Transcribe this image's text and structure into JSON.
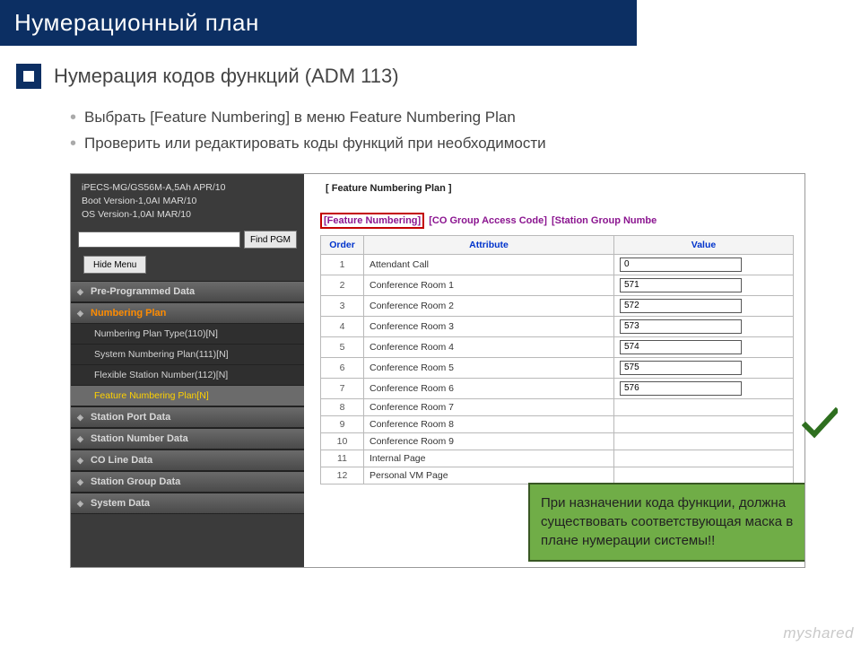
{
  "banner": {
    "title": "Нумерационный план"
  },
  "subtitle": "Нумерация кодов функций (ADM 113)",
  "bullets": [
    "Выбрать [Feature Numbering] в меню Feature Numbering Plan",
    "Проверить или редактировать коды функций при необходимости"
  ],
  "sidebar": {
    "info": [
      "iPECS-MG/GS56M-A,5Ah APR/10",
      "Boot Version-1,0AI MAR/10",
      "OS Version-1,0AI MAR/10"
    ],
    "find_btn": "Find PGM",
    "hide_btn": "Hide Menu",
    "groups": [
      {
        "label": "Pre-Programmed Data",
        "active": false
      },
      {
        "label": "Numbering Plan",
        "active": true,
        "items": [
          {
            "label": "Numbering Plan Type(110)[N]",
            "sel": false
          },
          {
            "label": "System Numbering Plan(111)[N]",
            "sel": false
          },
          {
            "label": "Flexible Station Number(112)[N]",
            "sel": false
          },
          {
            "label": "Feature Numbering Plan[N]",
            "sel": true
          }
        ]
      },
      {
        "label": "Station Port Data",
        "active": false
      },
      {
        "label": "Station Number Data",
        "active": false
      },
      {
        "label": "CO Line Data",
        "active": false
      },
      {
        "label": "Station Group Data",
        "active": false
      },
      {
        "label": "System Data",
        "active": false
      }
    ]
  },
  "content": {
    "breadcrumb": "[  Feature Numbering Plan  ]",
    "tabs": [
      {
        "label": "[Feature Numbering]",
        "boxed": true
      },
      {
        "label": "[CO Group Access Code]",
        "boxed": false
      },
      {
        "label": "[Station Group Numbe",
        "boxed": false
      }
    ],
    "cols": {
      "order": "Order",
      "attr": "Attribute",
      "val": "Value"
    },
    "rows": [
      {
        "order": "1",
        "attr": "Attendant Call",
        "val": "0"
      },
      {
        "order": "2",
        "attr": "Conference Room 1",
        "val": "571"
      },
      {
        "order": "3",
        "attr": "Conference Room 2",
        "val": "572"
      },
      {
        "order": "4",
        "attr": "Conference Room 3",
        "val": "573"
      },
      {
        "order": "5",
        "attr": "Conference Room 4",
        "val": "574"
      },
      {
        "order": "6",
        "attr": "Conference Room 5",
        "val": "575"
      },
      {
        "order": "7",
        "attr": "Conference Room 6",
        "val": "576"
      },
      {
        "order": "8",
        "attr": "Conference Room 7",
        "val": ""
      },
      {
        "order": "9",
        "attr": "Conference Room 8",
        "val": ""
      },
      {
        "order": "10",
        "attr": "Conference Room 9",
        "val": ""
      },
      {
        "order": "11",
        "attr": "Internal Page",
        "val": ""
      },
      {
        "order": "12",
        "attr": "Personal VM Page",
        "val": ""
      }
    ]
  },
  "callout": "При назначении кода функции, должна существовать соответствующая маска в плане нумерации системы!!",
  "watermark": "myshared"
}
